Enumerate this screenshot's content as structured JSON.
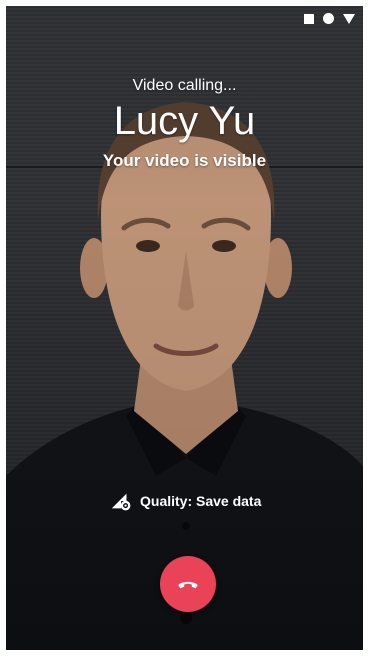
{
  "call": {
    "status": "Video calling...",
    "contact_name": "Lucy Yu",
    "video_state": "Your video is visible",
    "quality_label": "Quality: Save data"
  },
  "icons": {
    "status_bar": [
      "square-icon",
      "circle-icon",
      "triangle-down-icon"
    ],
    "quality": "signal-settings-icon",
    "end_call": "phone-hangup-icon"
  },
  "colors": {
    "end_call": "#ea4256",
    "text": "#ffffff"
  }
}
